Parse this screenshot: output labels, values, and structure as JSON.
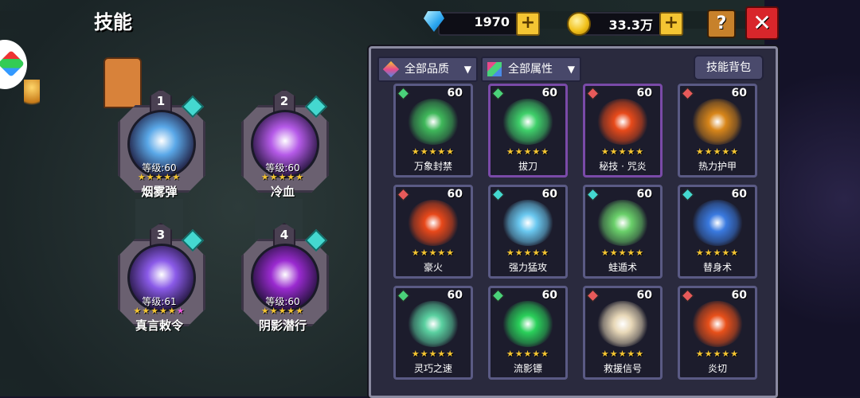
{
  "screen": {
    "title": "技能"
  },
  "currencies": {
    "gems": {
      "value": "1970",
      "icon": "diamond-icon"
    },
    "gold": {
      "value": "33.3万",
      "icon": "coin-icon"
    }
  },
  "buttons": {
    "help": "?",
    "close": "✕",
    "add": "+"
  },
  "equipped": [
    {
      "slot": "1",
      "level": "等级:60",
      "stars": "★★★★★",
      "extra_star": "",
      "name": "烟雾弹",
      "color": "#5aa8e8"
    },
    {
      "slot": "2",
      "level": "等级:60",
      "stars": "★★★★★",
      "extra_star": "",
      "name": "冷血",
      "color": "#b55ae8"
    },
    {
      "slot": "3",
      "level": "等级:61",
      "stars": "★★★★★",
      "extra_star": "★",
      "name": "真言敕令",
      "color": "#8a5ae8"
    },
    {
      "slot": "4",
      "level": "等级:60",
      "stars": "★★★★★",
      "extra_star": "",
      "name": "阴影潜行",
      "color": "#9a2ad0"
    }
  ],
  "panel": {
    "filter_quality": "全部品质",
    "filter_attr": "全部属性",
    "dropdown_arrow": "▼",
    "bag_button": "技能背包"
  },
  "skills": [
    {
      "name": "万象封禁",
      "level": "60",
      "stars": "★★★★★",
      "color": "#3fb85a",
      "gem": "#4ad27a",
      "frame": "blue"
    },
    {
      "name": "拔刀",
      "level": "60",
      "stars": "★★★★★",
      "color": "#3fd06a",
      "gem": "#4ad27a",
      "frame": "purple"
    },
    {
      "name": "秘技 · 咒炎",
      "level": "60",
      "stars": "★★★★★",
      "color": "#e84a1a",
      "gem": "#e85a5a",
      "frame": "purple"
    },
    {
      "name": "热力护甲",
      "level": "60",
      "stars": "★★★★★",
      "color": "#d8861a",
      "gem": "#e85a5a",
      "frame": "blue"
    },
    {
      "name": "豪火",
      "level": "60",
      "stars": "★★★★★",
      "color": "#e8481a",
      "gem": "#e85a5a",
      "frame": "blue"
    },
    {
      "name": "强力猛攻",
      "level": "60",
      "stars": "★★★★★",
      "color": "#6ac8f0",
      "gem": "#44d8d0",
      "frame": "blue"
    },
    {
      "name": "蛙遁术",
      "level": "60",
      "stars": "★★★★★",
      "color": "#6ad06a",
      "gem": "#44d8d0",
      "frame": "blue"
    },
    {
      "name": "替身术",
      "level": "60",
      "stars": "★★★★★",
      "color": "#3a7ae0",
      "gem": "#44d8d0",
      "frame": "blue"
    },
    {
      "name": "灵巧之速",
      "level": "60",
      "stars": "★★★★★",
      "color": "#5ad0a0",
      "gem": "#4ad27a",
      "frame": "blue"
    },
    {
      "name": "流影镖",
      "level": "60",
      "stars": "★★★★★",
      "color": "#2ad05a",
      "gem": "#4ad27a",
      "frame": "blue"
    },
    {
      "name": "救援信号",
      "level": "60",
      "stars": "★★★★★",
      "color": "#e8d8b8",
      "gem": "#e85a5a",
      "frame": "blue"
    },
    {
      "name": "炎切",
      "level": "60",
      "stars": "★★★★★",
      "color": "#e8501a",
      "gem": "#e85a5a",
      "frame": "blue"
    }
  ]
}
